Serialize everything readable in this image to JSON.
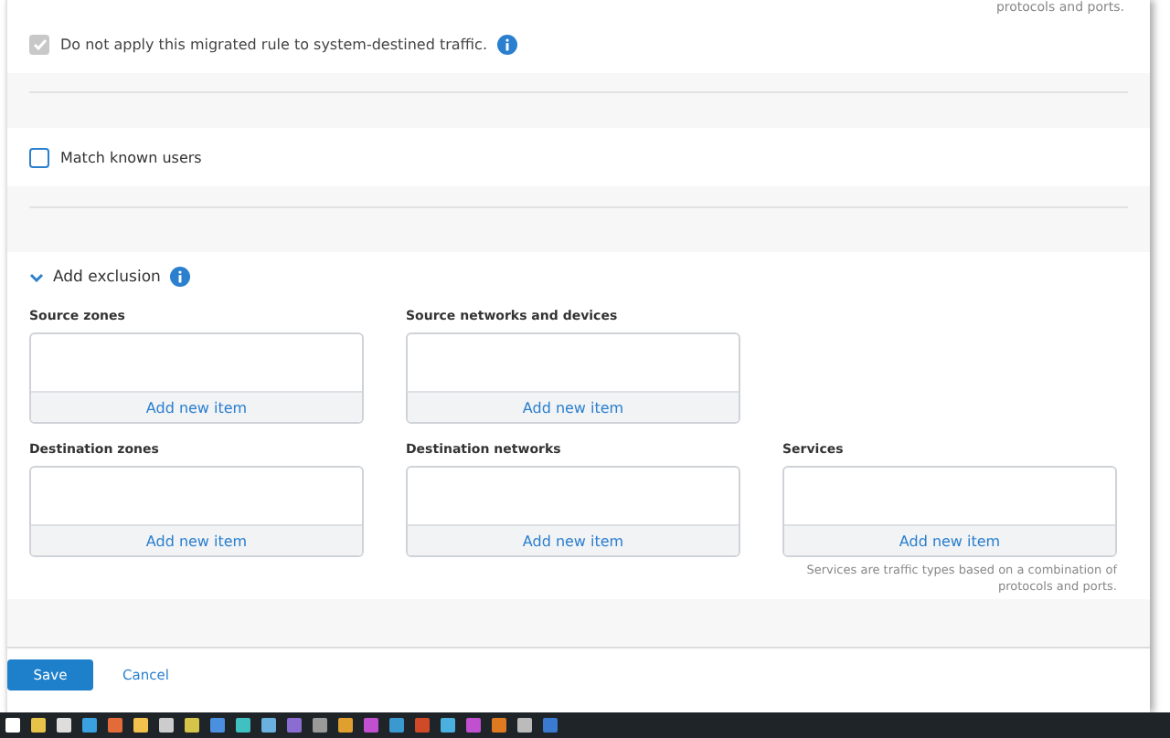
{
  "top_note": "protocols and ports.",
  "system_traffic": {
    "label": "Do not apply this migrated rule to system-destined traffic.",
    "checked": true,
    "disabled": true
  },
  "match_known_users": {
    "label": "Match known users",
    "checked": false
  },
  "exclusion": {
    "title": "Add exclusion",
    "expanded": true,
    "rows": [
      [
        {
          "label": "Source zones",
          "action": "Add new item"
        },
        {
          "label": "Source networks and devices",
          "action": "Add new item"
        }
      ],
      [
        {
          "label": "Destination zones",
          "action": "Add new item"
        },
        {
          "label": "Destination networks",
          "action": "Add new item"
        },
        {
          "label": "Services",
          "action": "Add new item",
          "hint": "Services are traffic types based on a combination of protocols and ports."
        }
      ]
    ]
  },
  "buttons": [
    {
      "label": "Save",
      "kind": "primary"
    },
    {
      "label": "Cancel",
      "kind": "link"
    }
  ]
}
